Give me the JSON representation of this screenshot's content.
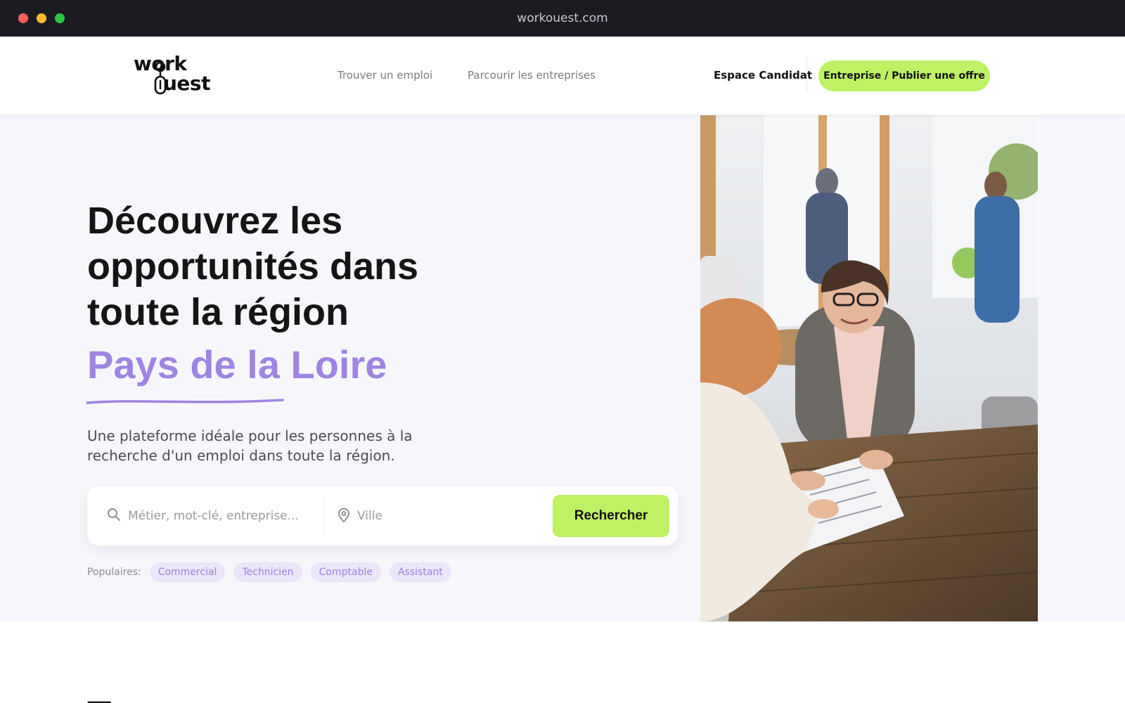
{
  "browser": {
    "url": "workouest.com"
  },
  "header": {
    "logo_line1": "work",
    "logo_line2": "uest",
    "nav": {
      "jobs": "Trouver un emploi",
      "companies": "Parcourir les entreprises"
    },
    "candidate_link": "Espace Candidat",
    "cta_label": "Entreprise / Publier une offre"
  },
  "hero": {
    "headline_lines": [
      "Découvrez les",
      "opportunités dans",
      "toute la région"
    ],
    "region": "Pays de la Loire",
    "subtitle": "Une plateforme idéale pour les personnes à la recherche d'un emploi dans toute la région.",
    "search": {
      "keyword_placeholder": "Métier, mot-clé, entreprise...",
      "keyword_value": "",
      "city_placeholder": "Ville",
      "city_value": "",
      "button_label": "Rechercher"
    },
    "popular": {
      "label": "Populaires:",
      "tags": [
        "Commercial",
        "Technicien",
        "Comptable",
        "Assistant"
      ]
    }
  },
  "colors": {
    "accent_purple": "#9f85e3",
    "accent_lime": "#bef264",
    "chrome_bg": "#1b1b22"
  },
  "icons": {
    "search": "search-icon",
    "location": "map-pin-icon"
  }
}
